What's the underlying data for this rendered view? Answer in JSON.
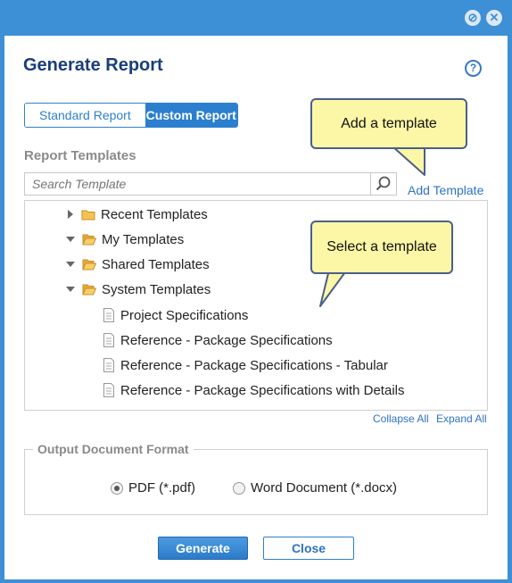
{
  "window": {
    "minimize_glyph": "⊘",
    "close_glyph": "✕"
  },
  "dialog": {
    "title": "Generate Report",
    "help_glyph": "?"
  },
  "tabs": {
    "standard": "Standard Report",
    "custom": "Custom Report",
    "active": "Custom Report"
  },
  "templates": {
    "section_label": "Report Templates",
    "search_placeholder": "Search Template",
    "search_value": "",
    "add_link": "Add Template",
    "tree": [
      {
        "label": "Recent Templates",
        "type": "folder",
        "expanded": false
      },
      {
        "label": "My Templates",
        "type": "folder",
        "expanded": true
      },
      {
        "label": "Shared Templates",
        "type": "folder",
        "expanded": true
      },
      {
        "label": "System Templates",
        "type": "folder",
        "expanded": true
      },
      {
        "label": "Project Specifications",
        "type": "file"
      },
      {
        "label": "Reference - Package Specifications",
        "type": "file"
      },
      {
        "label": "Reference - Package Specifications - Tabular",
        "type": "file"
      },
      {
        "label": "Reference - Package Specifications with Details",
        "type": "file"
      }
    ],
    "collapse_all": "Collapse All",
    "expand_all": "Expand All"
  },
  "output": {
    "legend": "Output Document Format",
    "options": [
      "PDF (*.pdf)",
      "Word Document (*.docx)"
    ],
    "selected": "PDF (*.pdf)"
  },
  "buttons": {
    "generate": "Generate",
    "close": "Close"
  },
  "callouts": {
    "add": "Add a template",
    "select": "Select a template"
  },
  "colors": {
    "frame": "#3d8fd6",
    "title": "#1a3e7a",
    "accent": "#2c7fce",
    "link": "#2f72c4",
    "callout_fill": "#fbf7a6",
    "callout_border": "#4a5f8a"
  }
}
